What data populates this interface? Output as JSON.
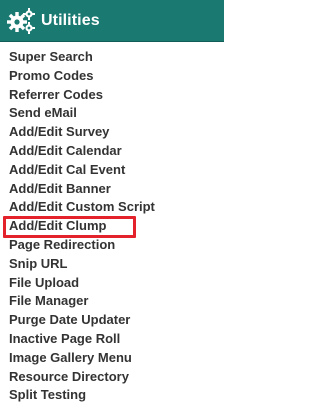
{
  "header": {
    "title": "Utilities",
    "icon": "gears-icon",
    "background_color": "#1a7a72"
  },
  "menu": {
    "items": [
      {
        "label": "Super Search"
      },
      {
        "label": "Promo Codes"
      },
      {
        "label": "Referrer Codes"
      },
      {
        "label": "Send eMail"
      },
      {
        "label": "Add/Edit Survey"
      },
      {
        "label": "Add/Edit Calendar"
      },
      {
        "label": "Add/Edit Cal Event"
      },
      {
        "label": "Add/Edit Banner"
      },
      {
        "label": "Add/Edit Custom Script"
      },
      {
        "label": "Add/Edit Clump"
      },
      {
        "label": "Page Redirection"
      },
      {
        "label": "Snip URL"
      },
      {
        "label": "File Upload"
      },
      {
        "label": "File Manager"
      },
      {
        "label": "Purge Date Updater"
      },
      {
        "label": "Inactive Page Roll"
      },
      {
        "label": "Image Gallery Menu"
      },
      {
        "label": "Resource Directory"
      },
      {
        "label": "Split Testing"
      }
    ]
  },
  "highlight": {
    "target": "Add/Edit Clump",
    "color": "#e3222b"
  }
}
